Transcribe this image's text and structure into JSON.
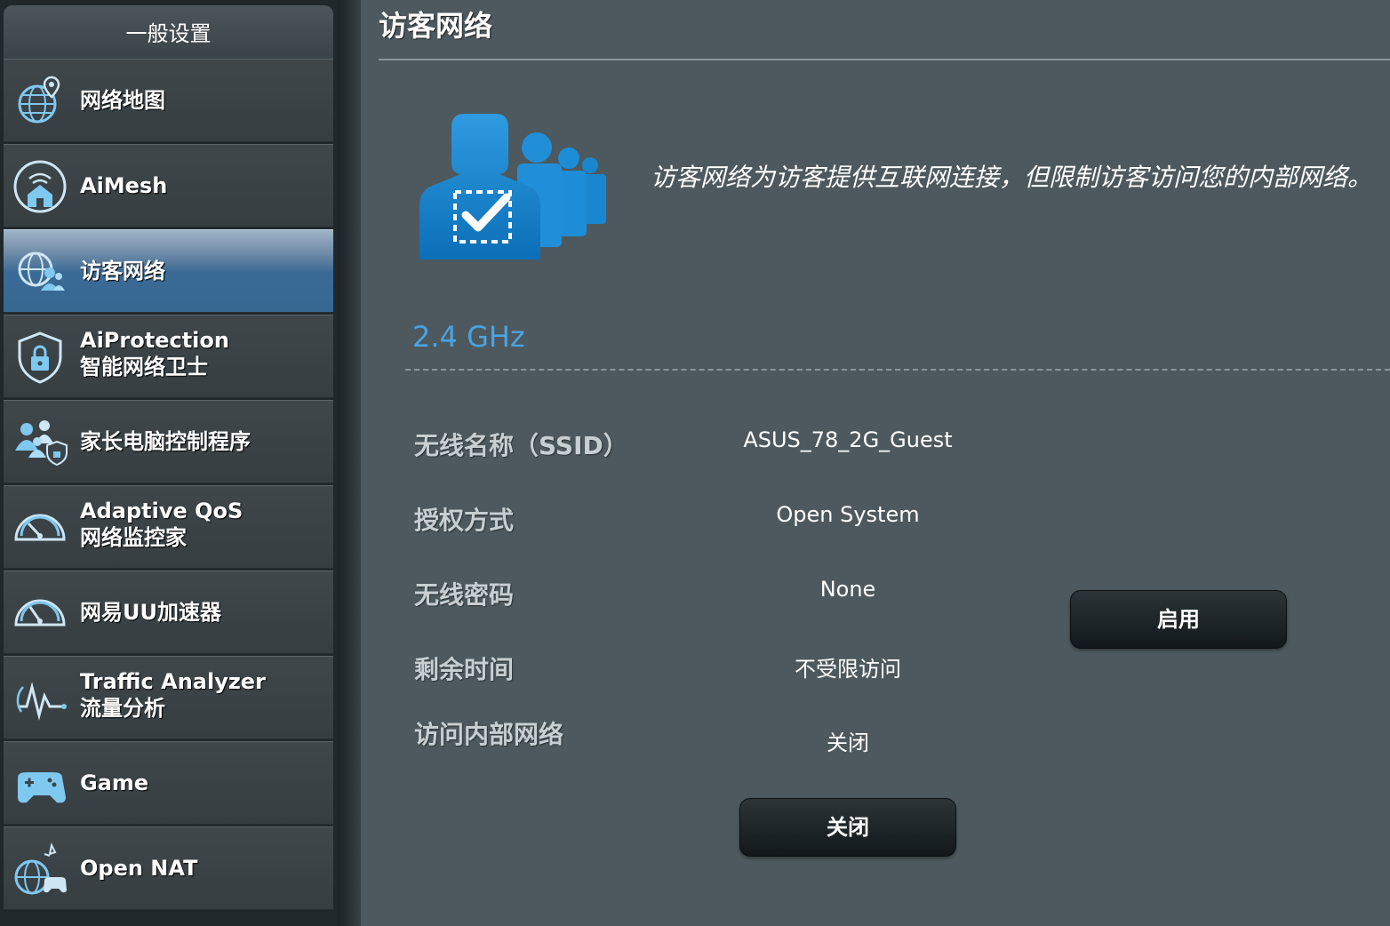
{
  "sidebar": {
    "header": "一般设置",
    "items": [
      {
        "label": "网络地图",
        "icon": "globe-pin-icon"
      },
      {
        "label": "AiMesh",
        "icon": "mesh-home-icon"
      },
      {
        "label": "访客网络",
        "icon": "guest-globe-icon",
        "active": true
      },
      {
        "label": "AiProtection",
        "sublabel": "智能网络卫士",
        "icon": "shield-lock-icon"
      },
      {
        "label": "家长电脑控制程序",
        "icon": "parental-control-icon"
      },
      {
        "label": "Adaptive QoS",
        "sublabel": "网络监控家",
        "icon": "speedometer-icon"
      },
      {
        "label": "网易UU加速器",
        "icon": "speedometer-icon"
      },
      {
        "label": "Traffic Analyzer",
        "sublabel": "流量分析",
        "icon": "traffic-wave-icon"
      },
      {
        "label": "Game",
        "icon": "gamepad-icon"
      },
      {
        "label": "Open NAT",
        "icon": "globe-gamepad-icon"
      }
    ]
  },
  "main": {
    "title": "访客网络",
    "description": "访客网络为访客提供互联网连接，但限制访客访问您的内部网络。",
    "band": "2.4 GHz",
    "fields": [
      {
        "label": "无线名称（SSID）",
        "value": "ASUS_78_2G_Guest"
      },
      {
        "label": "授权方式",
        "value": "Open System"
      },
      {
        "label": "无线密码",
        "value": "None"
      },
      {
        "label": "剩余时间",
        "value": "不受限访问"
      },
      {
        "label": "访问内部网络",
        "value": "关闭"
      }
    ],
    "enable_button": "启用",
    "close_button": "关闭"
  },
  "colors": {
    "accent": "#4aa3e3",
    "active_item": "#3b6a96",
    "panel_bg": "#4d595e"
  }
}
